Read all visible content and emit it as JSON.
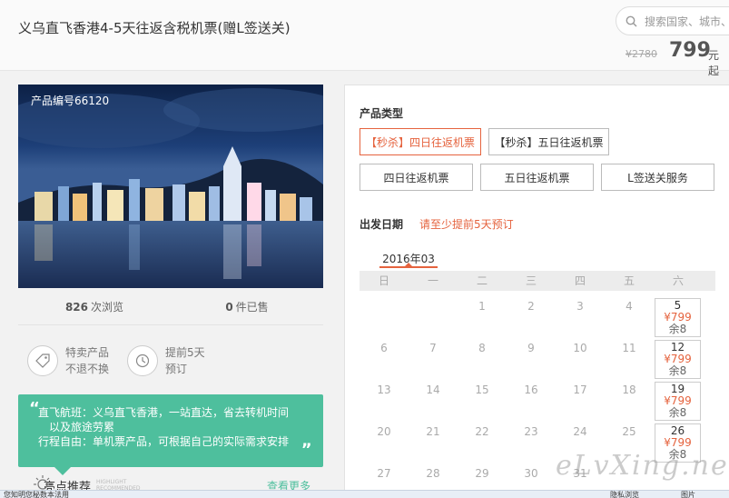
{
  "header": {
    "title": "义乌直飞香港4-5天往返含税机票(赠L签送关)",
    "search_placeholder": "搜索国家、城市、",
    "price_old": "¥2780",
    "price_now": "799",
    "price_unit": "元起"
  },
  "product": {
    "code": "产品编号66120",
    "views_num": "826",
    "views_label": "次浏览",
    "sold_num": "0",
    "sold_label": "件已售"
  },
  "features": [
    {
      "icon": "tag-icon",
      "line1": "特卖产品",
      "line2": "不退不换"
    },
    {
      "icon": "clock-icon",
      "line1": "提前5天",
      "line2": "预订"
    }
  ],
  "promo": {
    "open_quote": "“",
    "close_quote": "„",
    "line1": "直飞航班：义乌直飞香港，一站直达，省去转机时间",
    "line2": "以及旅途劳累",
    "line3": "行程自由：单机票产品，可根据自己的实际需求安排"
  },
  "highlights": {
    "label": "亮点推荐",
    "sub1": "HIGHLIGHT",
    "sub2": "RECOMMENDED",
    "more": "查看更多"
  },
  "booking": {
    "type_title": "产品类型",
    "options": [
      "【秒杀】四日往返机票",
      "【秒杀】五日往返机票",
      "四日往返机票",
      "五日往返机票",
      "L签送关服务"
    ],
    "selected_option": "【秒杀】四日往返机票",
    "date_title": "出发日期",
    "date_hint": "请至少提前5天预订",
    "month": "2016年03",
    "weekdays": [
      "日",
      "一",
      "二",
      "三",
      "四",
      "五",
      "六"
    ],
    "weeks": [
      [
        "",
        "",
        "1",
        "2",
        "3",
        "4",
        "5"
      ],
      [
        "6",
        "7",
        "8",
        "9",
        "10",
        "11",
        "12"
      ],
      [
        "13",
        "14",
        "15",
        "16",
        "17",
        "18",
        "19"
      ],
      [
        "20",
        "21",
        "22",
        "23",
        "24",
        "25",
        "26"
      ],
      [
        "27",
        "28",
        "29",
        "30",
        "31",
        "",
        ""
      ]
    ],
    "saturday_price": "¥799",
    "saturday_remaining": "余8"
  },
  "watermark": "eLvXing.net",
  "statusbar": {
    "left": "您知明您秘数本法用",
    "middle": "隐私浏览",
    "right": "图片"
  },
  "colors": {
    "accent": "#e5633e",
    "promo_green": "#4ebf9d"
  }
}
